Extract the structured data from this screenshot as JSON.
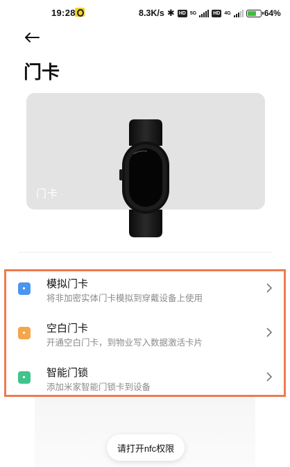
{
  "status_bar": {
    "time": "19:28",
    "speed": "8.3K/s",
    "hd1": "HD",
    "net1": "5G",
    "hd2": "HD",
    "net2": "4G",
    "battery_pct": "64%",
    "battery_level": 0.64
  },
  "header": {
    "title": "门卡",
    "back_icon": "back-arrow-icon"
  },
  "card": {
    "label": "门卡",
    "image": "smart-band-image"
  },
  "list": {
    "items": [
      {
        "title": "模拟门卡",
        "subtitle": "将非加密实体门卡模拟到穿戴设备上使用",
        "icon_color": "#4a95ef"
      },
      {
        "title": "空白门卡",
        "subtitle": "开通空白门卡，到物业写入数据激活卡片",
        "icon_color": "#f5a64b"
      },
      {
        "title": "智能门锁",
        "subtitle": "添加米家智能门锁卡到设备",
        "icon_color": "#3fc48c"
      }
    ],
    "highlight_color": "#ef7a4d"
  },
  "toast": {
    "text": "请打开nfc权限"
  }
}
